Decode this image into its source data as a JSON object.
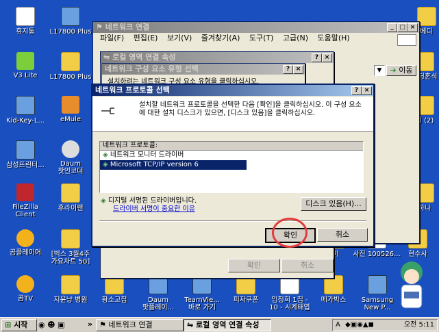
{
  "desktop": {
    "icons": [
      {
        "label": "휴지통"
      },
      {
        "label": "L17800 Plus"
      },
      {
        "label": "V3 Lite"
      },
      {
        "label": "L17800 Plus"
      },
      {
        "label": "Kid-Key-L..."
      },
      {
        "label": "eMule"
      },
      {
        "label": "삼성프린터..."
      },
      {
        "label": "Daum\n팟인코더"
      },
      {
        "label": "FileZilla\nClient"
      },
      {
        "label": "후라이팬"
      },
      {
        "label": "곰플레이어"
      },
      {
        "label": "[벅스 3월4주\n가요차트 50]"
      },
      {
        "label": "곰TV"
      },
      {
        "label": "지윤냥 병원"
      },
      {
        "label": "황소고집"
      },
      {
        "label": "Daum\n팟플레이..."
      },
      {
        "label": "TeamVie...\n바로 가기"
      },
      {
        "label": "피자쿠폰"
      },
      {
        "label": "임정희 1집 -\n10 - 시계태엽"
      },
      {
        "label": "메가박스"
      },
      {
        "label": "Samsung\nNew P..."
      },
      {
        "label": "웨딩혼식"
      },
      {
        "label": "더 (2)"
      },
      {
        "label": "하나"
      },
      {
        "label": "사진 100526..."
      },
      {
        "label": "현수사"
      },
      {
        "label": "베디"
      },
      {
        "label": "이"
      }
    ]
  },
  "network_window": {
    "title": "네트워크 연결",
    "menu": [
      "파일(F)",
      "편집(E)",
      "보기(V)",
      "즐겨찾기(A)",
      "도구(T)",
      "고급(N)",
      "도움말(H)"
    ],
    "go_label": "이동"
  },
  "props_window": {
    "title": "로컬 영역 연결 속성",
    "ok": "확인",
    "cancel": "취소"
  },
  "component_window": {
    "title": "네트워크 구성 요소 유형 선택",
    "partial_text": "설치하려는 네트워크 구성 요소 유형을 클릭하십시오."
  },
  "protocol_dialog": {
    "title": "네트워크 프로토콜 선택",
    "instruction": "설치할 네트워크 프로토콜을 선택한 다음 [확인]을 클릭하십시오. 이 구성 요소에 대한 설치 디스크가 있으면, [디스크 있음]을 클릭하십시오.",
    "list_header": "네트워크 프로토콜:",
    "list_items": [
      "네트워크 모니터 드라이버",
      "Microsoft TCP/IP version 6"
    ],
    "signed_text": "디지털 서명된 드라이버입니다.",
    "signing_link": "드라이버 서명이 중요한 이유",
    "have_disk": "디스크 있음(H)...",
    "ok": "확인",
    "cancel": "취소"
  },
  "taskbar": {
    "start": "시작",
    "items": [
      "네트워크 연결",
      "로컬 영역 연결 속성"
    ],
    "clock": "오전 5:11",
    "chevron": "»",
    "tray_lang": "A"
  },
  "colors": {
    "desktop": "#1a4fbf",
    "highlight": "#0a246a",
    "annotation": "#e23b3b"
  }
}
